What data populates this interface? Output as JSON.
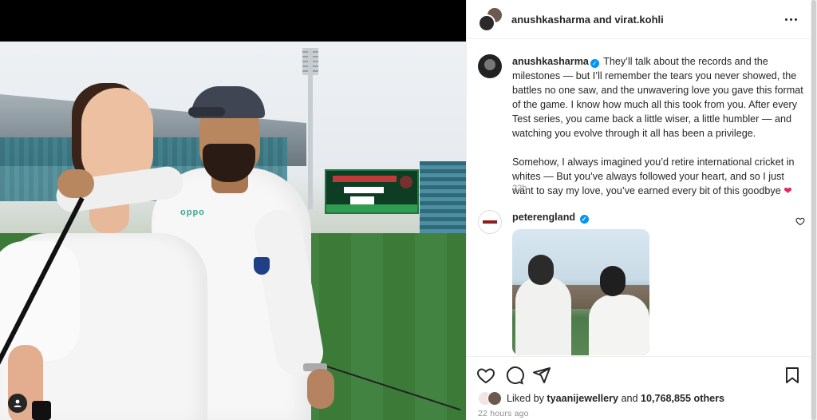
{
  "post": {
    "header": {
      "author_primary": "anushkasharma",
      "connector": " and ",
      "author_secondary": "virat.kohli"
    },
    "caption": {
      "username": "anushkasharma",
      "paragraph1": "They’ll talk about the records and the milestones — but I’ll remember the tears you never showed, the battles no one saw, and the unwavering love you gave this format of the game. I know how much all this took from you. After every Test series, you came back a little wiser, a little humbler — and watching you evolve through it all has been a privilege.",
      "paragraph2": "Somehow, I always imagined you’d retire international cricket in whites — But you’ve always followed your heart, and so I just want to say my love, you’ve earned every bit of this goodbye",
      "heart": "❤",
      "time": "22h"
    },
    "comment": {
      "username": "peterengland"
    },
    "likes": {
      "prefix": "Liked by ",
      "by_user": "tyaanijewellery",
      "middle": " and ",
      "count": "10,768,855 others"
    },
    "posted": "22 hours ago"
  },
  "photo": {
    "jersey_sponsor": "oppo"
  },
  "icons": {
    "verified": "✓",
    "more": "more-options-icon",
    "like": "heart-icon",
    "comment": "comment-icon",
    "share": "share-icon",
    "save": "bookmark-icon"
  },
  "colors": {
    "verified": "#0095f6",
    "text": "#262626",
    "muted": "#8e8e8e"
  }
}
